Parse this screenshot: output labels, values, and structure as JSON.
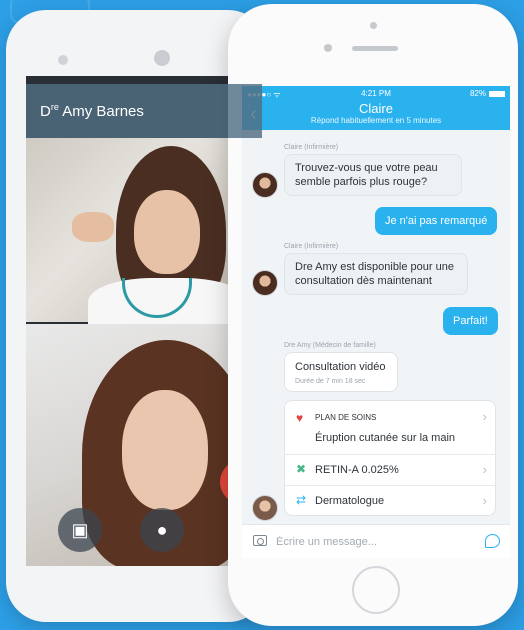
{
  "back_phone": {
    "doctor_name_prefix": "D",
    "doctor_name_sup": "re",
    "doctor_name": " Amy Barnes"
  },
  "status_bar": {
    "signal": "●●●●○ ᯤ",
    "time": "4:21 PM",
    "battery": "82%"
  },
  "header": {
    "contact_name": "Claire",
    "contact_status": "Répond habituellement en 5 minutes"
  },
  "messages": [
    {
      "sender": "Claire (Infirmière)",
      "text": "Trouvez-vous que votre peau semble parfois plus rouge?"
    },
    {
      "text": "Je n'ai pas remarqué"
    },
    {
      "sender": "Claire (Infirmière)",
      "text": "Dre Amy est disponible pour une consultation dès maintenant"
    },
    {
      "text": "Parfait!"
    }
  ],
  "video_card": {
    "sender": "Dre Amy (Médecin de famille)",
    "title": "Consultation vidéo",
    "duration": "Durée de 7 min 18 sec"
  },
  "care_plan": {
    "section_label": "PLAN DE SOINS",
    "condition": "Éruption cutanée sur la main",
    "medication": "RETIN-A 0.025%",
    "referral": "Dermatologue"
  },
  "composer": {
    "placeholder": "Écrire un message..."
  },
  "icons": {
    "back": "‹",
    "heart": "♥",
    "bandage": "✖",
    "transfer": "⇄",
    "chevron": "›",
    "phone_icon": "▣",
    "mic_icon": "●"
  },
  "colors": {
    "accent": "#29b2ee",
    "background": "#2d9fe6",
    "heart": "#e2453c",
    "bandage": "#43b88a"
  }
}
